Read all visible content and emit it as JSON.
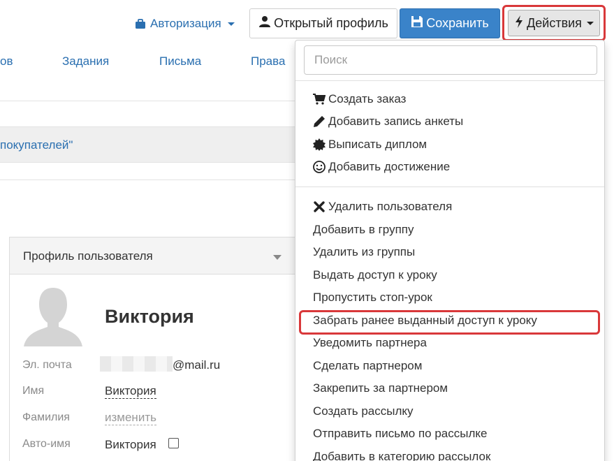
{
  "topbar": {
    "auth_label": "Авторизация",
    "open_profile_label": "Открытый профиль",
    "save_label": "Сохранить",
    "actions_label": "Действия"
  },
  "nav": {
    "items": [
      {
        "label": "ов"
      },
      {
        "label": "Задания"
      },
      {
        "label": "Письма"
      },
      {
        "label": "Права"
      }
    ]
  },
  "band": {
    "link_text": "покупателей\""
  },
  "profile": {
    "panel_title": "Профиль пользователя",
    "name": "Виктория",
    "fields": [
      {
        "label": "Эл. почта",
        "value": "@mail.ru"
      },
      {
        "label": "Имя",
        "value": "Виктория"
      },
      {
        "label": "Фамилия",
        "value": "изменить"
      },
      {
        "label": "Авто-имя",
        "value": "Виктория"
      }
    ]
  },
  "dropdown": {
    "search_placeholder": "Поиск",
    "group1": [
      {
        "label": "Создать заказ",
        "icon": "cart-icon"
      },
      {
        "label": "Добавить запись анкеты",
        "icon": "pencil-icon"
      },
      {
        "label": "Выписать диплом",
        "icon": "certificate-icon"
      },
      {
        "label": "Добавить достижение",
        "icon": "smile-icon"
      }
    ],
    "group2": [
      {
        "label": "Удалить пользователя",
        "icon": "close-icon"
      },
      {
        "label": "Добавить в группу"
      },
      {
        "label": "Удалить из группы"
      },
      {
        "label": "Выдать доступ к уроку"
      },
      {
        "label": "Пропустить стоп-урок"
      },
      {
        "label": "Забрать ранее выданный доступ к уроку"
      },
      {
        "label": "Уведомить партнера"
      },
      {
        "label": "Сделать партнером"
      },
      {
        "label": "Закрепить за партнером"
      },
      {
        "label": "Создать рассылку"
      },
      {
        "label": "Отправить письмо по рассылке"
      },
      {
        "label": "Добавить в категорию рассылок"
      }
    ]
  },
  "colors": {
    "link": "#2a6fb0",
    "save_button": "#3a83c9",
    "highlight": "#d9383a"
  }
}
